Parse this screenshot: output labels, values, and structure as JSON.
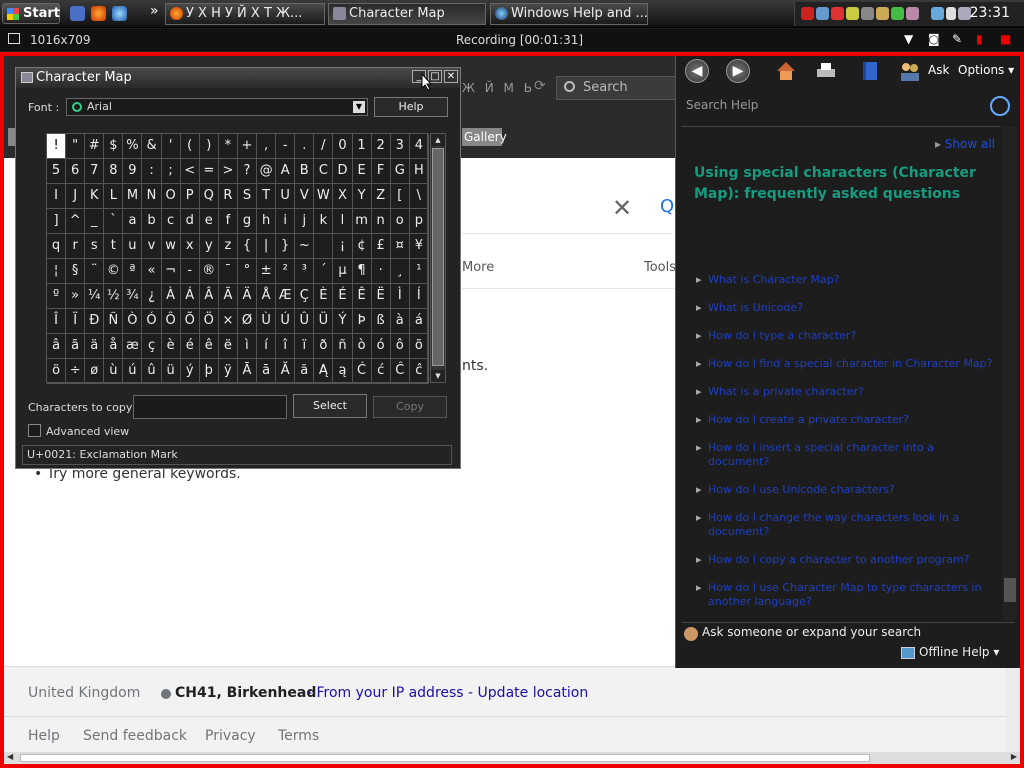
{
  "taskbar": {
    "start_label": "Start",
    "overflow": "»",
    "tasks": [
      {
        "label": "У Х Н У Й Х Т Ж..."
      },
      {
        "label": "Character Map"
      },
      {
        "label": "Windows Help and ..."
      }
    ],
    "clock": "23:31"
  },
  "recorder": {
    "resolution": "1016x709",
    "status": "Recording [00:01:31]"
  },
  "browser": {
    "cyrillic_tab": "Ж Й М Ь",
    "search_placeholder": "Search",
    "gallery_label": "Gallery",
    "tab_more": "More",
    "tab_tools": "Tools",
    "suggestion_tail": "nts.",
    "bullet_item": "Try more general keywords.",
    "footer": {
      "country": "United Kingdom",
      "location": "CH41, Birkenhead",
      "location_source": "- From your IP address - Update location",
      "links": [
        "Help",
        "Send feedback",
        "Privacy",
        "Terms"
      ]
    }
  },
  "charmap": {
    "title": "Character Map",
    "font_label": "Font :",
    "font_value": "Arial",
    "help_label": "Help",
    "chars": [
      "!",
      "\"",
      "#",
      "$",
      "%",
      "&",
      "'",
      "(",
      ")",
      "*",
      "+",
      ",",
      "-",
      ".",
      "/",
      "0",
      "1",
      "2",
      "3",
      "4",
      "5",
      "6",
      "7",
      "8",
      "9",
      ":",
      ";",
      "<",
      "=",
      ">",
      "?",
      "@",
      "A",
      "B",
      "C",
      "D",
      "E",
      "F",
      "G",
      "H",
      "I",
      "J",
      "K",
      "L",
      "M",
      "N",
      "O",
      "P",
      "Q",
      "R",
      "S",
      "T",
      "U",
      "V",
      "W",
      "X",
      "Y",
      "Z",
      "[",
      "\\",
      "]",
      "^",
      "_",
      "`",
      "a",
      "b",
      "c",
      "d",
      "e",
      "f",
      "g",
      "h",
      "i",
      "j",
      "k",
      "l",
      "m",
      "n",
      "o",
      "p",
      "q",
      "r",
      "s",
      "t",
      "u",
      "v",
      "w",
      "x",
      "y",
      "z",
      "{",
      "|",
      "}",
      "~",
      "",
      "¡",
      "¢",
      "£",
      "¤",
      "¥",
      "¦",
      "§",
      "¨",
      "©",
      "ª",
      "«",
      "¬",
      "-",
      "®",
      "¯",
      "°",
      "±",
      "²",
      "³",
      "´",
      "µ",
      "¶",
      "·",
      "¸",
      "¹",
      "º",
      "»",
      "¼",
      "½",
      "¾",
      "¿",
      "À",
      "Á",
      "Â",
      "Ã",
      "Ä",
      "Å",
      "Æ",
      "Ç",
      "È",
      "É",
      "Ê",
      "Ë",
      "Ì",
      "Í",
      "Î",
      "Ï",
      "Ð",
      "Ñ",
      "Ò",
      "Ó",
      "Ô",
      "Õ",
      "Ö",
      "×",
      "Ø",
      "Ù",
      "Ú",
      "Û",
      "Ü",
      "Ý",
      "Þ",
      "ß",
      "à",
      "á",
      "â",
      "ã",
      "ä",
      "å",
      "æ",
      "ç",
      "è",
      "é",
      "ê",
      "ë",
      "ì",
      "í",
      "î",
      "ï",
      "ð",
      "ñ",
      "ò",
      "ó",
      "ô",
      "õ",
      "ö",
      "÷",
      "ø",
      "ù",
      "ú",
      "û",
      "ü",
      "ý",
      "þ",
      "ÿ",
      "Ā",
      "ā",
      "Ă",
      "ă",
      "Ą",
      "ą",
      "Ć",
      "ć",
      "Ĉ",
      "ĉ"
    ],
    "copy_label": "Characters to copy",
    "copy_value": "",
    "select_label": "Select",
    "copy_button": "Copy",
    "advanced_label": "Advanced view",
    "status": "U+0021: Exclamation Mark"
  },
  "help": {
    "ask_label": "Ask",
    "options_label": "Options",
    "search_placeholder": "Search Help",
    "top_link": "Show all",
    "heading": "Using special characters (Character Map): frequently asked questions",
    "links": [
      "What is Character Map?",
      "What is Unicode?",
      "How do I type a character?",
      "How do I find a special character in Character Map?",
      "What is a private character?",
      "How do I create a private character?",
      "How do I insert a special character into a document?",
      "How do I use Unicode characters?",
      "How do I change the way characters look in a document?",
      "How do I copy a character to another program?",
      "How do I use Character Map to type characters in another language?"
    ],
    "ask_row": "Ask someone or expand your search",
    "offline": "Offline Help ▾"
  }
}
